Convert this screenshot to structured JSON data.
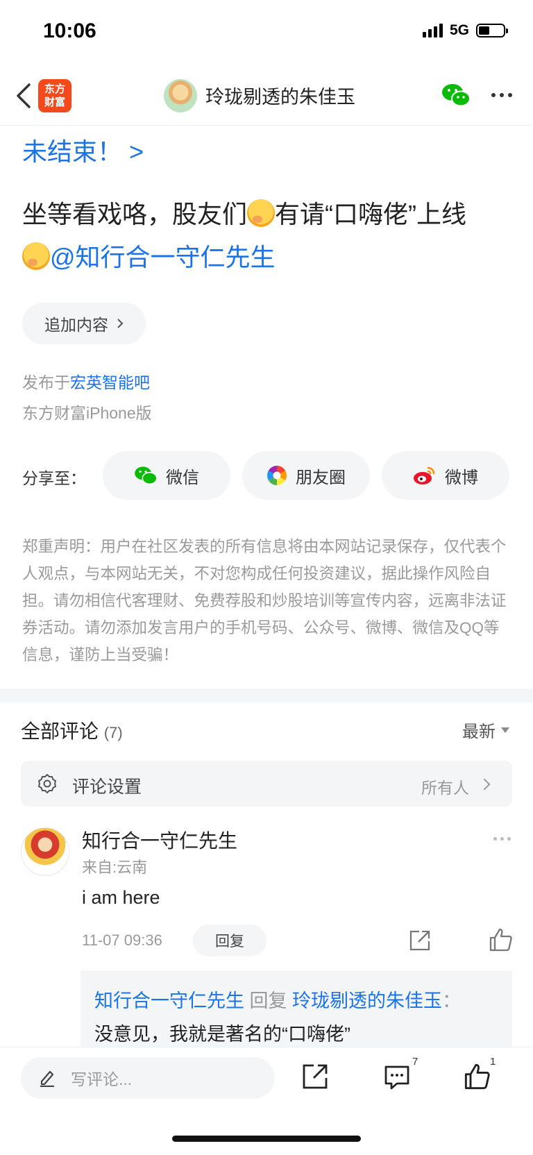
{
  "status_bar": {
    "time": "10:06",
    "network": "5G",
    "battery_level": 0.45
  },
  "nav": {
    "logo_line1": "东方",
    "logo_line2": "财富",
    "title": "玲珑剔透的朱佳玉"
  },
  "post": {
    "cut_link": "未结束！ >",
    "text_part1": "坐等看戏咯，股友们",
    "text_part2": "有请“口嗨佬”上线",
    "mention": "@知行合一守仁先生",
    "add_content": "追加内容",
    "published_prefix": "发布于",
    "bar_name": "宏英智能吧",
    "client": "东方财富iPhone版"
  },
  "share": {
    "label": "分享至：",
    "items": [
      {
        "label": "微信",
        "icon": "wechat-icon"
      },
      {
        "label": "朋友圈",
        "icon": "moments-icon"
      },
      {
        "label": "微博",
        "icon": "weibo-icon"
      }
    ]
  },
  "disclaimer": "郑重声明：用户在社区发表的所有信息将由本网站记录保存，仅代表个人观点，与本网站无关，不对您构成任何投资建议，据此操作风险自担。请勿相信代客理财、免费荐股和炒股培训等宣传内容，远离非法证券活动。请勿添加发言用户的手机号码、公众号、微博、微信及QQ等信息，谨防上当受骗！",
  "comments": {
    "title": "全部评论",
    "count": "(7)",
    "sort": "最新",
    "settings_label": "评论设置",
    "settings_value": "所有人",
    "items": [
      {
        "name": "知行合一守仁先生",
        "from": "来自:云南",
        "text": "i am here",
        "time": "11-07 09:36",
        "reply_label": "回复",
        "reply": {
          "from_user": "知行合一守仁先生",
          "verb": "回复",
          "to_user": "玲珑剔透的朱佳玉",
          "colon": "：",
          "text": "没意见，我就是著名的“口嗨佬”"
        }
      }
    ]
  },
  "bottom_bar": {
    "placeholder": "写评论...",
    "comment_count": "7",
    "like_count": "1"
  },
  "colors": {
    "link": "#1a73e8",
    "brand": "#f3491d",
    "wechat": "#09bb07"
  }
}
